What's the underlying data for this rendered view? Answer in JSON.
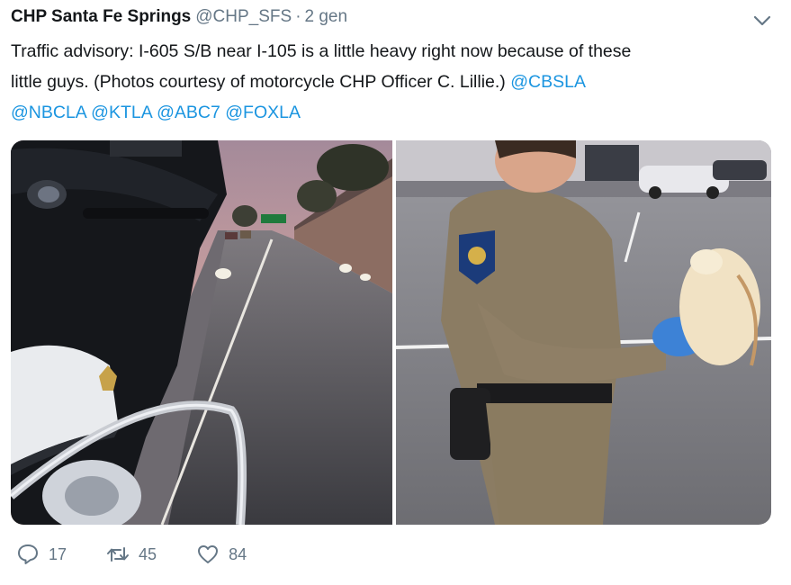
{
  "tweet": {
    "author_name": "CHP Santa Fe Springs",
    "handle": "@CHP_SFS",
    "separator": "·",
    "time": "2 gen",
    "text_line1": "Traffic advisory:  I-605 S/B near I-105 is a little heavy right now because of these",
    "text_line2_plain": "little guys. (Photos courtesy of motorcycle CHP Officer C. Lillie.) ",
    "mention_cbsla": "@CBSLA",
    "mention_nbcla": "@NBCLA",
    "mention_ktla": "@KTLA",
    "mention_abc7": "@ABC7",
    "mention_foxla": "@FOXLA"
  },
  "actions": {
    "reply_count": "17",
    "retweet_count": "45",
    "like_count": "84"
  },
  "icons": {
    "more": "chevron-down-icon",
    "reply": "reply-icon",
    "retweet": "retweet-icon",
    "like": "heart-icon"
  },
  "colors": {
    "text": "#14171a",
    "muted": "#657786",
    "link": "#1b95e0"
  }
}
